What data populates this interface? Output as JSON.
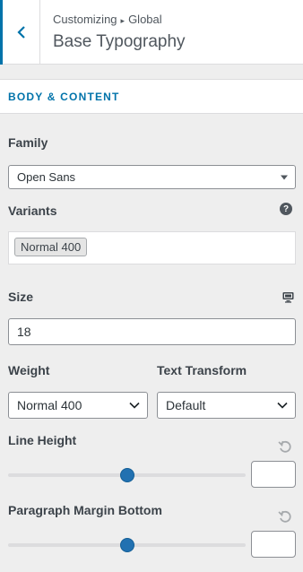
{
  "header": {
    "breadcrumb_parent": "Customizing",
    "breadcrumb_sep": "▸",
    "breadcrumb_child": "Global",
    "title": "Base Typography"
  },
  "section": {
    "title": "BODY & CONTENT"
  },
  "family": {
    "label": "Family",
    "value": "Open Sans"
  },
  "variants": {
    "label": "Variants",
    "help_icon": "?",
    "selected": [
      "Normal 400"
    ]
  },
  "size": {
    "label": "Size",
    "value": "18",
    "device_icon": "desktop-icon"
  },
  "weight": {
    "label": "Weight",
    "value": "Normal 400"
  },
  "text_transform": {
    "label": "Text Transform",
    "value": "Default"
  },
  "line_height": {
    "label": "Line Height",
    "slider_fraction": 0.5,
    "value": ""
  },
  "paragraph_margin": {
    "label": "Paragraph Margin Bottom",
    "slider_fraction": 0.5,
    "value": ""
  },
  "colors": {
    "accent": "#0073aa",
    "thumb": "#2271b1",
    "track": "#dcdcde",
    "background": "#eeeeee"
  }
}
